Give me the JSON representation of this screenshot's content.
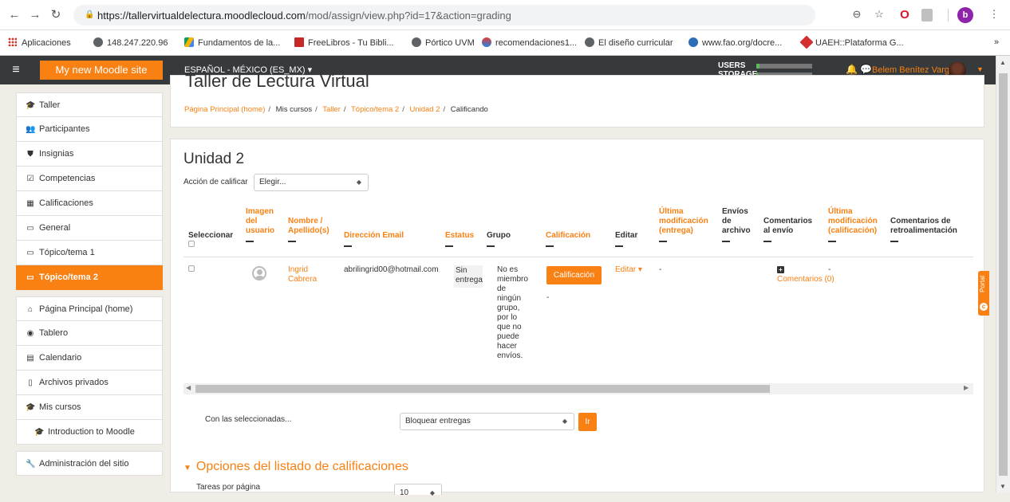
{
  "browser": {
    "url_host": "https://tallervirtualdelectura.moodlecloud.com",
    "url_path": "/mod/assign/view.php?id=17&action=grading",
    "profile_letter": "b",
    "bookmarks": [
      {
        "label": "Aplicaciones",
        "icon": "apps-icon"
      },
      {
        "label": "148.247.220.96",
        "icon": "globe-icon"
      },
      {
        "label": "Fundamentos de la...",
        "icon": "drive-icon"
      },
      {
        "label": "FreeLibros - Tu Bibli...",
        "icon": "book-icon"
      },
      {
        "label": "Pórtico UVM",
        "icon": "globe-icon"
      },
      {
        "label": "recomendaciones1...",
        "icon": "chrome-icon"
      },
      {
        "label": "El diseño curricular",
        "icon": "globe-icon"
      },
      {
        "label": "www.fao.org/docre...",
        "icon": "fao-icon"
      },
      {
        "label": "UAEH::Plataforma G...",
        "icon": "uaeh-icon"
      }
    ],
    "more_bookmarks": "»"
  },
  "navbar": {
    "site_title": "My new Moodle site",
    "language": "ESPAÑOL - MÉXICO (ES_MX) ▾",
    "users_label": "USERS",
    "storage_label": "STORAGE",
    "user_name": "Belem Benítez Vargas",
    "accent": "#f98012"
  },
  "sidebar": {
    "items": [
      {
        "label": "Taller",
        "icon": "graduation-cap-icon"
      },
      {
        "label": "Participantes",
        "icon": "users-icon"
      },
      {
        "label": "Insignias",
        "icon": "shield-icon"
      },
      {
        "label": "Competencias",
        "icon": "check-square-icon"
      },
      {
        "label": "Calificaciones",
        "icon": "table-icon"
      },
      {
        "label": "General",
        "icon": "folder-icon"
      },
      {
        "label": "Tópico/tema 1",
        "icon": "folder-icon"
      },
      {
        "label": "Tópico/tema 2",
        "icon": "folder-icon"
      }
    ],
    "items2": [
      {
        "label": "Página Principal (home)",
        "icon": "home-icon"
      },
      {
        "label": "Tablero",
        "icon": "dashboard-icon"
      },
      {
        "label": "Calendario",
        "icon": "calendar-icon"
      },
      {
        "label": "Archivos privados",
        "icon": "file-icon"
      },
      {
        "label": "Mis cursos",
        "icon": "graduation-cap-icon"
      },
      {
        "label": "Introduction to Moodle",
        "icon": "graduation-cap-icon"
      }
    ],
    "admin": {
      "label": "Administración del sitio",
      "icon": "wrench-icon"
    }
  },
  "header": {
    "course_title": "Taller de Lectura Virtual",
    "breadcrumb": [
      "Página Principal (home)",
      "Mis cursos",
      "Taller",
      "Tópico/tema 2",
      "Unidad 2",
      "Calificando"
    ]
  },
  "main": {
    "title": "Unidad 2",
    "grade_action_label": "Acción de calificar",
    "grade_action_value": "Elegir...",
    "columns": {
      "select": "Seleccionar",
      "user_image": "Imagen del usuario",
      "name": "Nombre / Apellido(s)",
      "email": "Dirección Email",
      "status": "Estatus",
      "group": "Grupo",
      "grade": "Calificación",
      "edit": "Editar",
      "last_mod_submission": "Última modificación (entrega)",
      "file_submissions": "Envíos de archivo",
      "submission_comments": "Comentarios al envío",
      "last_mod_grade": "Última modificación (calificación)",
      "feedback_comments": "Comentarios de retroalimentación"
    },
    "row": {
      "name": "Ingrid Cabrera",
      "email": "abrilingrid00@hotmail.com",
      "status": "Sin entrega",
      "group": "No es miembro de ningún grupo, por lo que no puede hacer envíos.",
      "grade_button": "Calificación",
      "grade_dash": "-",
      "edit": "Editar ▾",
      "last_mod_submission": "-",
      "comments": "Comentarios (0)",
      "last_mod_grade": "-"
    },
    "with_selected_label": "Con las seleccionadas...",
    "with_selected_value": "Bloquear entregas",
    "go_button": "Ir",
    "options_title": "Opciones del listado de calificaciones",
    "per_page_label": "Tareas por página",
    "per_page_value": "10"
  },
  "portal_tab": "Portal"
}
